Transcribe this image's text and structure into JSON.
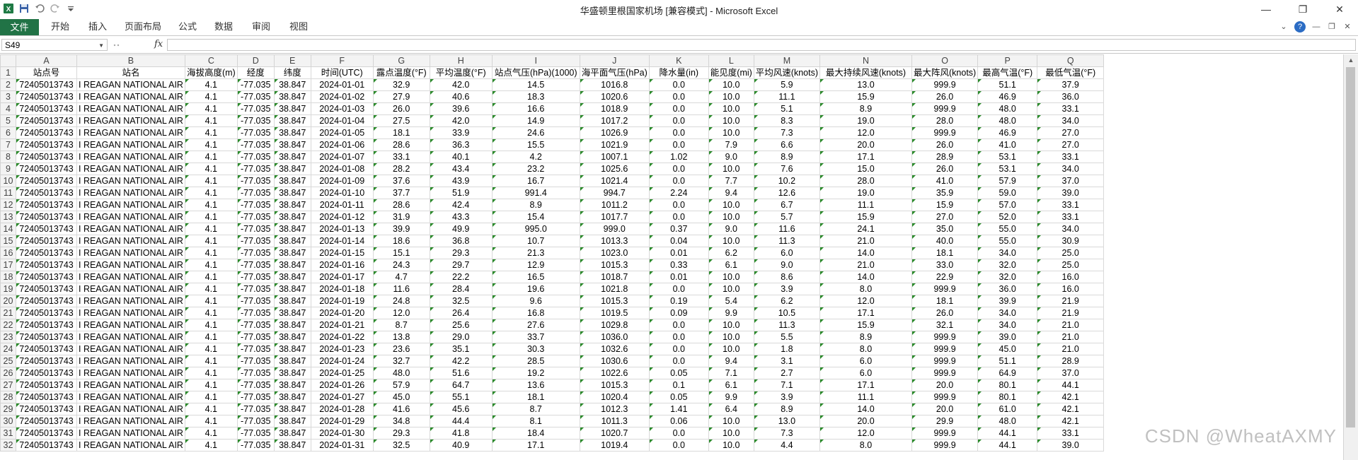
{
  "window": {
    "title": "华盛顿里根国家机场  [兼容模式]  -  Microsoft Excel",
    "controls": [
      "—",
      "❐",
      "✕"
    ]
  },
  "ribbon": {
    "file_tab": "文件",
    "tabs": [
      "开始",
      "插入",
      "页面布局",
      "公式",
      "数据",
      "审阅",
      "视图"
    ]
  },
  "formula_bar": {
    "name_box": "S49",
    "fx": "fx",
    "value": ""
  },
  "columns": [
    "A",
    "B",
    "C",
    "D",
    "E",
    "F",
    "G",
    "H",
    "I",
    "J",
    "K",
    "L",
    "M",
    "N",
    "O",
    "P",
    "Q"
  ],
  "header_fields": [
    "站点号",
    "站名",
    "海拔高度(m)",
    "经度",
    "纬度",
    "时间(UTC)",
    "露点温度(°F)",
    "平均温度(°F)",
    "站点气压(hPa)(1000)",
    "海平面气压(hPa)",
    "降水量(in)",
    "能见度(mi)",
    "平均风速(knots)",
    "最大持续风速(knots)",
    "最大阵风(knots)",
    "最高气温(°F)",
    "最低气温(°F)"
  ],
  "rows": [
    [
      "72405013743",
      "I REAGAN NATIONAL AIR",
      "4.1",
      "-77.035",
      "38.847",
      "2024-01-01",
      "32.9",
      "42.0",
      "14.5",
      "1016.8",
      "0.0",
      "10.0",
      "5.9",
      "13.0",
      "999.9",
      "51.1",
      "37.9"
    ],
    [
      "72405013743",
      "I REAGAN NATIONAL AIR",
      "4.1",
      "-77.035",
      "38.847",
      "2024-01-02",
      "27.9",
      "40.6",
      "18.3",
      "1020.6",
      "0.0",
      "10.0",
      "11.1",
      "15.9",
      "26.0",
      "46.9",
      "36.0"
    ],
    [
      "72405013743",
      "I REAGAN NATIONAL AIR",
      "4.1",
      "-77.035",
      "38.847",
      "2024-01-03",
      "26.0",
      "39.6",
      "16.6",
      "1018.9",
      "0.0",
      "10.0",
      "5.1",
      "8.9",
      "999.9",
      "48.0",
      "33.1"
    ],
    [
      "72405013743",
      "I REAGAN NATIONAL AIR",
      "4.1",
      "-77.035",
      "38.847",
      "2024-01-04",
      "27.5",
      "42.0",
      "14.9",
      "1017.2",
      "0.0",
      "10.0",
      "8.3",
      "19.0",
      "28.0",
      "48.0",
      "34.0"
    ],
    [
      "72405013743",
      "I REAGAN NATIONAL AIR",
      "4.1",
      "-77.035",
      "38.847",
      "2024-01-05",
      "18.1",
      "33.9",
      "24.6",
      "1026.9",
      "0.0",
      "10.0",
      "7.3",
      "12.0",
      "999.9",
      "46.9",
      "27.0"
    ],
    [
      "72405013743",
      "I REAGAN NATIONAL AIR",
      "4.1",
      "-77.035",
      "38.847",
      "2024-01-06",
      "28.6",
      "36.3",
      "15.5",
      "1021.9",
      "0.0",
      "7.9",
      "6.6",
      "20.0",
      "26.0",
      "41.0",
      "27.0"
    ],
    [
      "72405013743",
      "I REAGAN NATIONAL AIR",
      "4.1",
      "-77.035",
      "38.847",
      "2024-01-07",
      "33.1",
      "40.1",
      "4.2",
      "1007.1",
      "1.02",
      "9.0",
      "8.9",
      "17.1",
      "28.9",
      "53.1",
      "33.1"
    ],
    [
      "72405013743",
      "I REAGAN NATIONAL AIR",
      "4.1",
      "-77.035",
      "38.847",
      "2024-01-08",
      "28.2",
      "43.4",
      "23.2",
      "1025.6",
      "0.0",
      "10.0",
      "7.6",
      "15.0",
      "26.0",
      "53.1",
      "34.0"
    ],
    [
      "72405013743",
      "I REAGAN NATIONAL AIR",
      "4.1",
      "-77.035",
      "38.847",
      "2024-01-09",
      "37.6",
      "43.9",
      "16.7",
      "1021.4",
      "0.0",
      "7.7",
      "10.2",
      "28.0",
      "41.0",
      "57.9",
      "37.0"
    ],
    [
      "72405013743",
      "I REAGAN NATIONAL AIR",
      "4.1",
      "-77.035",
      "38.847",
      "2024-01-10",
      "37.7",
      "51.9",
      "991.4",
      "994.7",
      "2.24",
      "9.4",
      "12.6",
      "19.0",
      "35.9",
      "59.0",
      "39.0"
    ],
    [
      "72405013743",
      "I REAGAN NATIONAL AIR",
      "4.1",
      "-77.035",
      "38.847",
      "2024-01-11",
      "28.6",
      "42.4",
      "8.9",
      "1011.2",
      "0.0",
      "10.0",
      "6.7",
      "11.1",
      "15.9",
      "57.0",
      "33.1"
    ],
    [
      "72405013743",
      "I REAGAN NATIONAL AIR",
      "4.1",
      "-77.035",
      "38.847",
      "2024-01-12",
      "31.9",
      "43.3",
      "15.4",
      "1017.7",
      "0.0",
      "10.0",
      "5.7",
      "15.9",
      "27.0",
      "52.0",
      "33.1"
    ],
    [
      "72405013743",
      "I REAGAN NATIONAL AIR",
      "4.1",
      "-77.035",
      "38.847",
      "2024-01-13",
      "39.9",
      "49.9",
      "995.0",
      "999.0",
      "0.37",
      "9.0",
      "11.6",
      "24.1",
      "35.0",
      "55.0",
      "34.0"
    ],
    [
      "72405013743",
      "I REAGAN NATIONAL AIR",
      "4.1",
      "-77.035",
      "38.847",
      "2024-01-14",
      "18.6",
      "36.8",
      "10.7",
      "1013.3",
      "0.04",
      "10.0",
      "11.3",
      "21.0",
      "40.0",
      "55.0",
      "30.9"
    ],
    [
      "72405013743",
      "I REAGAN NATIONAL AIR",
      "4.1",
      "-77.035",
      "38.847",
      "2024-01-15",
      "15.1",
      "29.3",
      "21.3",
      "1023.0",
      "0.01",
      "6.2",
      "6.0",
      "14.0",
      "18.1",
      "34.0",
      "25.0"
    ],
    [
      "72405013743",
      "I REAGAN NATIONAL AIR",
      "4.1",
      "-77.035",
      "38.847",
      "2024-01-16",
      "24.3",
      "29.7",
      "12.9",
      "1015.3",
      "0.33",
      "6.1",
      "9.0",
      "21.0",
      "33.0",
      "32.0",
      "25.0"
    ],
    [
      "72405013743",
      "I REAGAN NATIONAL AIR",
      "4.1",
      "-77.035",
      "38.847",
      "2024-01-17",
      "4.7",
      "22.2",
      "16.5",
      "1018.7",
      "0.01",
      "10.0",
      "8.6",
      "14.0",
      "22.9",
      "32.0",
      "16.0"
    ],
    [
      "72405013743",
      "I REAGAN NATIONAL AIR",
      "4.1",
      "-77.035",
      "38.847",
      "2024-01-18",
      "11.6",
      "28.4",
      "19.6",
      "1021.8",
      "0.0",
      "10.0",
      "3.9",
      "8.0",
      "999.9",
      "36.0",
      "16.0"
    ],
    [
      "72405013743",
      "I REAGAN NATIONAL AIR",
      "4.1",
      "-77.035",
      "38.847",
      "2024-01-19",
      "24.8",
      "32.5",
      "9.6",
      "1015.3",
      "0.19",
      "5.4",
      "6.2",
      "12.0",
      "18.1",
      "39.9",
      "21.9"
    ],
    [
      "72405013743",
      "I REAGAN NATIONAL AIR",
      "4.1",
      "-77.035",
      "38.847",
      "2024-01-20",
      "12.0",
      "26.4",
      "16.8",
      "1019.5",
      "0.09",
      "9.9",
      "10.5",
      "17.1",
      "26.0",
      "34.0",
      "21.9"
    ],
    [
      "72405013743",
      "I REAGAN NATIONAL AIR",
      "4.1",
      "-77.035",
      "38.847",
      "2024-01-21",
      "8.7",
      "25.6",
      "27.6",
      "1029.8",
      "0.0",
      "10.0",
      "11.3",
      "15.9",
      "32.1",
      "34.0",
      "21.0"
    ],
    [
      "72405013743",
      "I REAGAN NATIONAL AIR",
      "4.1",
      "-77.035",
      "38.847",
      "2024-01-22",
      "13.8",
      "29.0",
      "33.7",
      "1036.0",
      "0.0",
      "10.0",
      "5.5",
      "8.9",
      "999.9",
      "39.0",
      "21.0"
    ],
    [
      "72405013743",
      "I REAGAN NATIONAL AIR",
      "4.1",
      "-77.035",
      "38.847",
      "2024-01-23",
      "23.6",
      "35.1",
      "30.3",
      "1032.6",
      "0.0",
      "10.0",
      "1.8",
      "8.0",
      "999.9",
      "45.0",
      "21.0"
    ],
    [
      "72405013743",
      "I REAGAN NATIONAL AIR",
      "4.1",
      "-77.035",
      "38.847",
      "2024-01-24",
      "32.7",
      "42.2",
      "28.5",
      "1030.6",
      "0.0",
      "9.4",
      "3.1",
      "6.0",
      "999.9",
      "51.1",
      "28.9"
    ],
    [
      "72405013743",
      "I REAGAN NATIONAL AIR",
      "4.1",
      "-77.035",
      "38.847",
      "2024-01-25",
      "48.0",
      "51.6",
      "19.2",
      "1022.6",
      "0.05",
      "7.1",
      "2.7",
      "6.0",
      "999.9",
      "64.9",
      "37.0"
    ],
    [
      "72405013743",
      "I REAGAN NATIONAL AIR",
      "4.1",
      "-77.035",
      "38.847",
      "2024-01-26",
      "57.9",
      "64.7",
      "13.6",
      "1015.3",
      "0.1",
      "6.1",
      "7.1",
      "17.1",
      "20.0",
      "80.1",
      "44.1"
    ],
    [
      "72405013743",
      "I REAGAN NATIONAL AIR",
      "4.1",
      "-77.035",
      "38.847",
      "2024-01-27",
      "45.0",
      "55.1",
      "18.1",
      "1020.4",
      "0.05",
      "9.9",
      "3.9",
      "11.1",
      "999.9",
      "80.1",
      "42.1"
    ],
    [
      "72405013743",
      "I REAGAN NATIONAL AIR",
      "4.1",
      "-77.035",
      "38.847",
      "2024-01-28",
      "41.6",
      "45.6",
      "8.7",
      "1012.3",
      "1.41",
      "6.4",
      "8.9",
      "14.0",
      "20.0",
      "61.0",
      "42.1"
    ],
    [
      "72405013743",
      "I REAGAN NATIONAL AIR",
      "4.1",
      "-77.035",
      "38.847",
      "2024-01-29",
      "34.8",
      "44.4",
      "8.1",
      "1011.3",
      "0.06",
      "10.0",
      "13.0",
      "20.0",
      "29.9",
      "48.0",
      "42.1"
    ],
    [
      "72405013743",
      "I REAGAN NATIONAL AIR",
      "4.1",
      "-77.035",
      "38.847",
      "2024-01-30",
      "29.3",
      "41.8",
      "18.4",
      "1020.7",
      "0.0",
      "10.0",
      "7.3",
      "12.0",
      "999.9",
      "44.1",
      "33.1"
    ],
    [
      "72405013743",
      "I REAGAN NATIONAL AIR",
      "4.1",
      "-77.035",
      "38.847",
      "2024-01-31",
      "32.5",
      "40.9",
      "17.1",
      "1019.4",
      "0.0",
      "10.0",
      "4.4",
      "8.0",
      "999.9",
      "44.1",
      "39.0"
    ]
  ],
  "row_numbers": [
    "1",
    "2",
    "3",
    "4",
    "5",
    "6",
    "7",
    "8",
    "9",
    "10",
    "11",
    "12",
    "13",
    "14",
    "15",
    "16",
    "17",
    "18",
    "19",
    "20",
    "21",
    "22",
    "23",
    "24",
    "25",
    "26",
    "27",
    "28",
    "29",
    "30",
    "31",
    "32"
  ],
  "watermark": "CSDN @WheatAXMY",
  "colors": {
    "accent": "#217346",
    "error_triangle": "#2a8a2a"
  }
}
